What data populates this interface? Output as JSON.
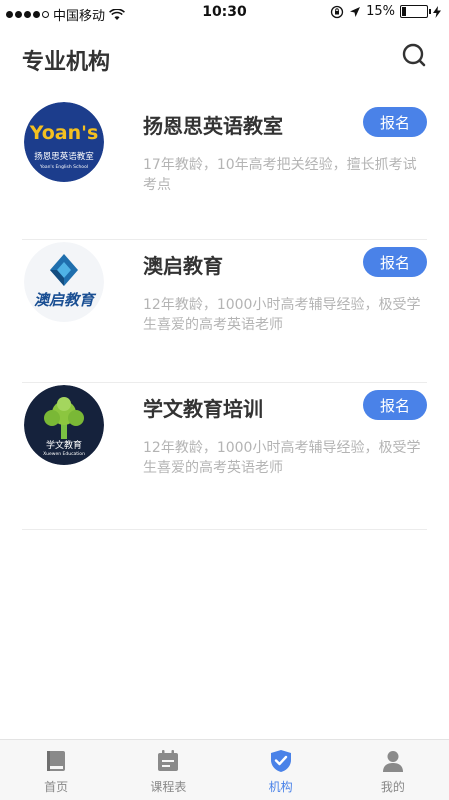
{
  "status_bar": {
    "carrier": "中国移动",
    "time": "10:30",
    "battery": "15%",
    "battery_level": 0.15
  },
  "header": {
    "title": "专业机构"
  },
  "institutions": [
    {
      "name": "扬恩思英语教室",
      "button": "报名",
      "desc": "17年教龄，10年高考把关经验，擅长抓考试考点",
      "logo_text": "扬恩思英语教室",
      "logo_brand": "Yoan's",
      "logo_sub": "Yoan's English School"
    },
    {
      "name": "澳启教育",
      "button": "报名",
      "desc": "12年教龄，1000小时高考辅导经验，极受学生喜爱的高考英语老师",
      "logo_text": "澳启教育"
    },
    {
      "name": "学文教育培训",
      "button": "报名",
      "desc": "12年教龄，1000小时高考辅导经验，极受学生喜爱的高考英语老师",
      "logo_text": "学文教育",
      "logo_sub": "Xuewen Education"
    }
  ],
  "tabs": [
    {
      "label": "首页",
      "icon": "book-icon"
    },
    {
      "label": "课程表",
      "icon": "calendar-icon"
    },
    {
      "label": "机构",
      "icon": "shield-check-icon",
      "active": true
    },
    {
      "label": "我的",
      "icon": "user-icon"
    }
  ],
  "colors": {
    "accent": "#4a82e8",
    "text_primary": "#333333",
    "text_secondary": "#b4b4b4",
    "tab_inactive": "#888888"
  }
}
